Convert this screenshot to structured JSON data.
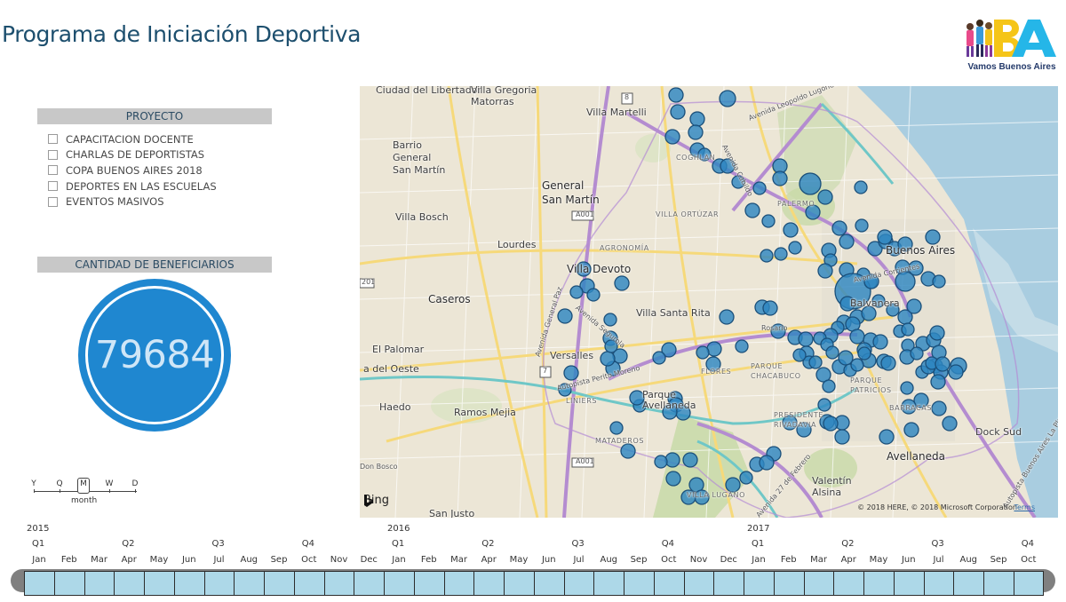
{
  "header": {
    "title": "Programa de Iniciación Deportiva",
    "logo_text": "Vamos Buenos Aires",
    "logo_mark": "BA"
  },
  "project_slicer": {
    "title": "PROYECTO",
    "items": [
      {
        "label": "CAPACITACION DOCENTE",
        "checked": false
      },
      {
        "label": "CHARLAS DE DEPORTISTAS",
        "checked": false
      },
      {
        "label": "COPA BUENOS AIRES 2018",
        "checked": false
      },
      {
        "label": "DEPORTES EN LAS ESCUELAS",
        "checked": false
      },
      {
        "label": "EVENTOS MASIVOS",
        "checked": false
      }
    ]
  },
  "kpi": {
    "title": "CANTIDAD DE BENEFICIARIOS",
    "value": "79684",
    "color": "#1f87d0"
  },
  "granularity": {
    "options": [
      "Y",
      "Q",
      "M",
      "W",
      "D"
    ],
    "selected": "M",
    "selected_label": "month"
  },
  "map": {
    "provider": "Bing",
    "copyright": "© 2018 HERE, © 2018 Microsoft Corporation",
    "terms": "Terms",
    "marker_color": "#2e86c1",
    "labels": {
      "ciudad_del_libertador": "Ciudad del Libertador",
      "villa_gregoria": "Villa Gregoria Matorras",
      "villa_martelli": "Villa Martelli",
      "barrio_gsm": "Barrio General San Martín",
      "general_san_martin": "General San Martín",
      "villa_bosch": "Villa Bosch",
      "lourdes": "Lourdes",
      "villa_devoto": "Villa Devoto",
      "caseros": "Caseros",
      "villa_santa_rita": "Villa Santa Rita",
      "el_palomar": "El Palomar",
      "versalles": "Versalles",
      "del_oeste": "a del Oeste",
      "haedo": "Haedo",
      "ramos_mejia": "Ramos Mejia",
      "parque_avellaneda": "Parque Avellaneda",
      "buenos_aires": "Buenos Aires",
      "balvanera": "Balvanera",
      "dock_sud": "Dock Sud",
      "avellaneda": "Avellaneda",
      "valentin_alsina": "Valentín Alsina",
      "san_justo": "San Justo",
      "don_bosco": "Don Bosco",
      "palermo": "PALERMO",
      "villa_ortuzar": "VILLA ORTÚZAR",
      "agronomia": "AGRONOMÍA",
      "flores": "FLORES",
      "parque_chacabuco": "PARQUE CHACABUCO",
      "parque_patricios": "PARQUE PATRICIOS",
      "barracas": "BARRACAS",
      "presidente_rivadavia": "PRESIDENTE RIVADAVIA",
      "liniers": "LINIERS",
      "mataderos": "MATADEROS",
      "villa_lugano": "VILLA LUGANO",
      "coghlan": "COGHLAN",
      "av_lugones": "Avenida Leopoldo Lugones",
      "av_corrientes": "Avenida Corrientes",
      "av_cabildo": "Avenida Cabildo",
      "rosario": "Rosario",
      "autopista_perito_moreno": "Autopista Perito Moreno",
      "av_27_febrero": "Avenida 27 de Febrero",
      "av_general_paz": "Avenida General Paz",
      "av_segurola": "Avenida Segurola",
      "autopista_la_plata": "Autopista Buenos Aires La Plata",
      "a001": "A001",
      "r201": "201",
      "r8": "8",
      "r7": "7"
    }
  },
  "timeline": {
    "years": [
      "2015",
      "2016",
      "2017"
    ],
    "quarters": [
      "Q1",
      "Q2",
      "Q3",
      "Q4",
      "Q1",
      "Q2",
      "Q3",
      "Q4",
      "Q1",
      "Q2",
      "Q3",
      "Q4"
    ],
    "months": [
      "Jan",
      "Feb",
      "Mar",
      "Apr",
      "May",
      "Jun",
      "Jul",
      "Aug",
      "Sep",
      "Oct",
      "Nov",
      "Dec",
      "Jan",
      "Feb",
      "Mar",
      "Apr",
      "May",
      "Jun",
      "Jul",
      "Aug",
      "Sep",
      "Oct",
      "Nov",
      "Dec",
      "Jan",
      "Feb",
      "Mar",
      "Apr",
      "May",
      "Jun",
      "Jul",
      "Aug",
      "Sep",
      "Oct"
    ],
    "selected_color": "#add8e8"
  }
}
